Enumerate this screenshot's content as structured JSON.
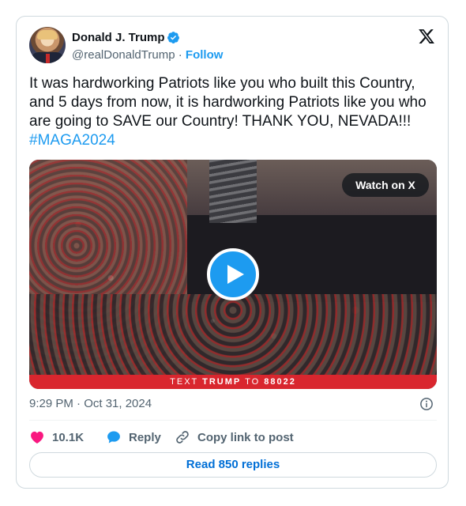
{
  "author": {
    "name": "Donald J. Trump",
    "handle": "@realDonaldTrump",
    "separator": "·",
    "follow_label": "Follow"
  },
  "tweet": {
    "text": "It was hardworking Patriots like you who built this Country, and 5 days from now, it is hardworking Patriots like you who are going to SAVE our Country! THANK YOU, NEVADA!!! ",
    "hashtag": "#MAGA2024"
  },
  "media": {
    "watch_label": "Watch on X",
    "banner_prefix": "TEXT",
    "banner_keyword": "TRUMP",
    "banner_middle": "TO",
    "banner_number": "88022"
  },
  "timestamp": "9:29 PM · Oct 31, 2024",
  "actions": {
    "likes": "10.1K",
    "reply_label": "Reply",
    "copy_label": "Copy link to post"
  },
  "read_replies_label": "Read 850 replies",
  "colors": {
    "accent": "#1d9bf0",
    "like": "#f91880",
    "banner": "#d9262e",
    "muted": "#536471"
  },
  "icons": [
    "verified-badge-icon",
    "x-logo-icon",
    "play-icon",
    "heart-icon",
    "reply-bubble-icon",
    "link-icon",
    "info-icon"
  ]
}
